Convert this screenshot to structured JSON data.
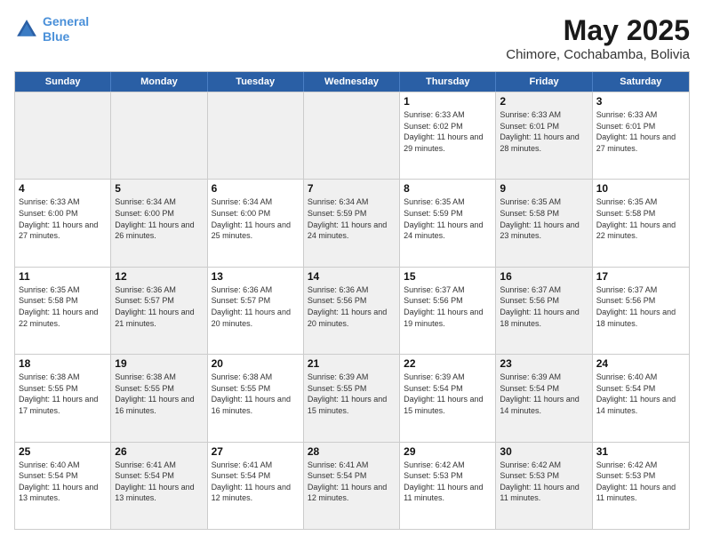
{
  "header": {
    "logo_line1": "General",
    "logo_line2": "Blue",
    "title": "May 2025",
    "subtitle": "Chimore, Cochabamba, Bolivia"
  },
  "days_of_week": [
    "Sunday",
    "Monday",
    "Tuesday",
    "Wednesday",
    "Thursday",
    "Friday",
    "Saturday"
  ],
  "weeks": [
    [
      {
        "day": "",
        "text": "",
        "shaded": true
      },
      {
        "day": "",
        "text": "",
        "shaded": true
      },
      {
        "day": "",
        "text": "",
        "shaded": true
      },
      {
        "day": "",
        "text": "",
        "shaded": true
      },
      {
        "day": "1",
        "text": "Sunrise: 6:33 AM\nSunset: 6:02 PM\nDaylight: 11 hours and 29 minutes.",
        "shaded": false
      },
      {
        "day": "2",
        "text": "Sunrise: 6:33 AM\nSunset: 6:01 PM\nDaylight: 11 hours and 28 minutes.",
        "shaded": true
      },
      {
        "day": "3",
        "text": "Sunrise: 6:33 AM\nSunset: 6:01 PM\nDaylight: 11 hours and 27 minutes.",
        "shaded": false
      }
    ],
    [
      {
        "day": "4",
        "text": "Sunrise: 6:33 AM\nSunset: 6:00 PM\nDaylight: 11 hours and 27 minutes.",
        "shaded": false
      },
      {
        "day": "5",
        "text": "Sunrise: 6:34 AM\nSunset: 6:00 PM\nDaylight: 11 hours and 26 minutes.",
        "shaded": true
      },
      {
        "day": "6",
        "text": "Sunrise: 6:34 AM\nSunset: 6:00 PM\nDaylight: 11 hours and 25 minutes.",
        "shaded": false
      },
      {
        "day": "7",
        "text": "Sunrise: 6:34 AM\nSunset: 5:59 PM\nDaylight: 11 hours and 24 minutes.",
        "shaded": true
      },
      {
        "day": "8",
        "text": "Sunrise: 6:35 AM\nSunset: 5:59 PM\nDaylight: 11 hours and 24 minutes.",
        "shaded": false
      },
      {
        "day": "9",
        "text": "Sunrise: 6:35 AM\nSunset: 5:58 PM\nDaylight: 11 hours and 23 minutes.",
        "shaded": true
      },
      {
        "day": "10",
        "text": "Sunrise: 6:35 AM\nSunset: 5:58 PM\nDaylight: 11 hours and 22 minutes.",
        "shaded": false
      }
    ],
    [
      {
        "day": "11",
        "text": "Sunrise: 6:35 AM\nSunset: 5:58 PM\nDaylight: 11 hours and 22 minutes.",
        "shaded": false
      },
      {
        "day": "12",
        "text": "Sunrise: 6:36 AM\nSunset: 5:57 PM\nDaylight: 11 hours and 21 minutes.",
        "shaded": true
      },
      {
        "day": "13",
        "text": "Sunrise: 6:36 AM\nSunset: 5:57 PM\nDaylight: 11 hours and 20 minutes.",
        "shaded": false
      },
      {
        "day": "14",
        "text": "Sunrise: 6:36 AM\nSunset: 5:56 PM\nDaylight: 11 hours and 20 minutes.",
        "shaded": true
      },
      {
        "day": "15",
        "text": "Sunrise: 6:37 AM\nSunset: 5:56 PM\nDaylight: 11 hours and 19 minutes.",
        "shaded": false
      },
      {
        "day": "16",
        "text": "Sunrise: 6:37 AM\nSunset: 5:56 PM\nDaylight: 11 hours and 18 minutes.",
        "shaded": true
      },
      {
        "day": "17",
        "text": "Sunrise: 6:37 AM\nSunset: 5:56 PM\nDaylight: 11 hours and 18 minutes.",
        "shaded": false
      }
    ],
    [
      {
        "day": "18",
        "text": "Sunrise: 6:38 AM\nSunset: 5:55 PM\nDaylight: 11 hours and 17 minutes.",
        "shaded": false
      },
      {
        "day": "19",
        "text": "Sunrise: 6:38 AM\nSunset: 5:55 PM\nDaylight: 11 hours and 16 minutes.",
        "shaded": true
      },
      {
        "day": "20",
        "text": "Sunrise: 6:38 AM\nSunset: 5:55 PM\nDaylight: 11 hours and 16 minutes.",
        "shaded": false
      },
      {
        "day": "21",
        "text": "Sunrise: 6:39 AM\nSunset: 5:55 PM\nDaylight: 11 hours and 15 minutes.",
        "shaded": true
      },
      {
        "day": "22",
        "text": "Sunrise: 6:39 AM\nSunset: 5:54 PM\nDaylight: 11 hours and 15 minutes.",
        "shaded": false
      },
      {
        "day": "23",
        "text": "Sunrise: 6:39 AM\nSunset: 5:54 PM\nDaylight: 11 hours and 14 minutes.",
        "shaded": true
      },
      {
        "day": "24",
        "text": "Sunrise: 6:40 AM\nSunset: 5:54 PM\nDaylight: 11 hours and 14 minutes.",
        "shaded": false
      }
    ],
    [
      {
        "day": "25",
        "text": "Sunrise: 6:40 AM\nSunset: 5:54 PM\nDaylight: 11 hours and 13 minutes.",
        "shaded": false
      },
      {
        "day": "26",
        "text": "Sunrise: 6:41 AM\nSunset: 5:54 PM\nDaylight: 11 hours and 13 minutes.",
        "shaded": true
      },
      {
        "day": "27",
        "text": "Sunrise: 6:41 AM\nSunset: 5:54 PM\nDaylight: 11 hours and 12 minutes.",
        "shaded": false
      },
      {
        "day": "28",
        "text": "Sunrise: 6:41 AM\nSunset: 5:54 PM\nDaylight: 11 hours and 12 minutes.",
        "shaded": true
      },
      {
        "day": "29",
        "text": "Sunrise: 6:42 AM\nSunset: 5:53 PM\nDaylight: 11 hours and 11 minutes.",
        "shaded": false
      },
      {
        "day": "30",
        "text": "Sunrise: 6:42 AM\nSunset: 5:53 PM\nDaylight: 11 hours and 11 minutes.",
        "shaded": true
      },
      {
        "day": "31",
        "text": "Sunrise: 6:42 AM\nSunset: 5:53 PM\nDaylight: 11 hours and 11 minutes.",
        "shaded": false
      }
    ]
  ]
}
